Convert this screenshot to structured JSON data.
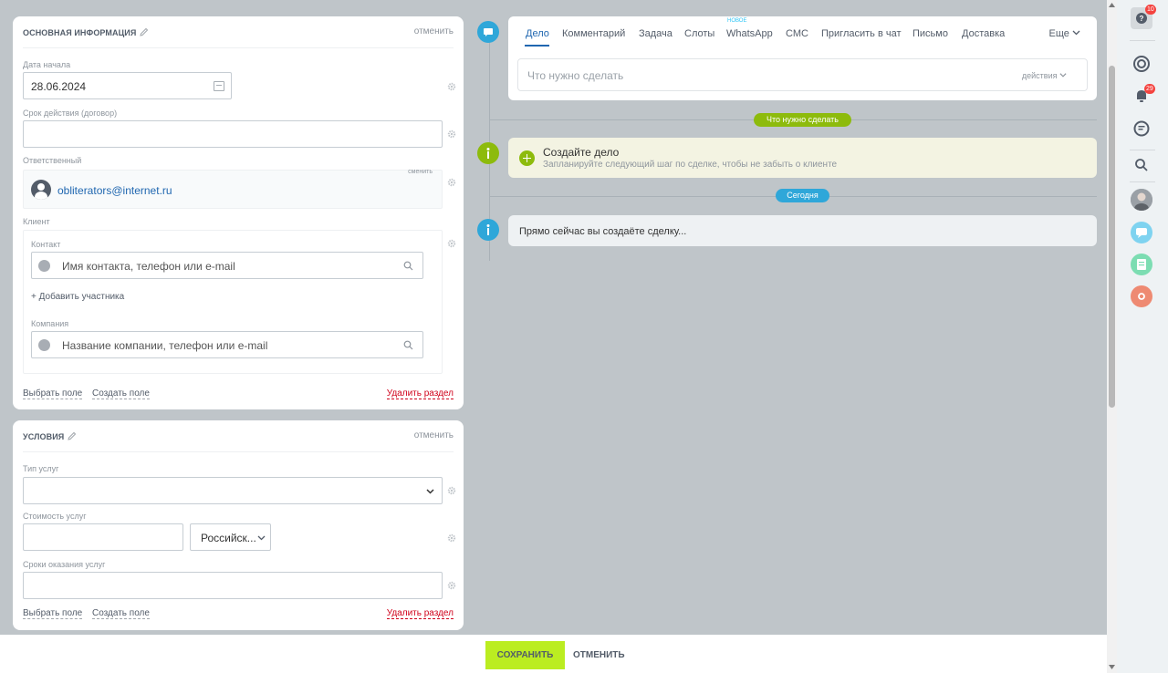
{
  "main_section": {
    "title": "ОСНОВНАЯ ИНФОРМАЦИЯ",
    "cancel": "отменить",
    "start_date_label": "Дата начала",
    "start_date_value": "28.06.2024",
    "term_label": "Срок действия (договор)",
    "term_value": "",
    "responsible_label": "Ответственный",
    "responsible_change": "сменить",
    "responsible_email": "obliterators@internet.ru",
    "client_label": "Клиент",
    "contact_label": "Контакт",
    "contact_placeholder": "Имя контакта, телефон или e-mail",
    "add_participant": "+ Добавить участника",
    "company_label": "Компания",
    "company_placeholder": "Название компании, телефон или e-mail",
    "select_field": "Выбрать поле",
    "create_field": "Создать поле",
    "delete_section": "Удалить раздел"
  },
  "conditions_section": {
    "title": "УСЛОВИЯ",
    "cancel": "отменить",
    "service_type_label": "Тип услуг",
    "service_cost_label": "Стоимость услуг",
    "currency_value": "Российск...",
    "service_terms_label": "Сроки оказания услуг",
    "select_field": "Выбрать поле",
    "create_field": "Создать поле",
    "delete_section": "Удалить раздел"
  },
  "timeline": {
    "tabs": [
      {
        "label": "Дело"
      },
      {
        "label": "Комментарий"
      },
      {
        "label": "Задача"
      },
      {
        "label": "Слоты"
      },
      {
        "label": "WhatsApp"
      },
      {
        "label": "СМС"
      },
      {
        "label": "Пригласить в чат"
      },
      {
        "label": "Письмо"
      },
      {
        "label": "Доставка"
      }
    ],
    "new_badge": "НОВОЕ",
    "more_tab": "Еще",
    "todo_placeholder": "Что нужно сделать",
    "actions": "действия",
    "todo_pill": "Что нужно сделать",
    "create_title": "Создайте дело",
    "create_subtitle": "Запланируйте следующий шаг по сделке, чтобы не забыть о клиенте",
    "today_pill": "Сегодня",
    "now_text": "Прямо сейчас вы создаёте сделку..."
  },
  "rail": {
    "help_badge": "10",
    "notifications_badge": "29"
  },
  "bottom": {
    "save": "СОХРАНИТЬ",
    "cancel": "ОТМЕНИТЬ"
  },
  "colors": {
    "accent_green": "#bbed21",
    "link_blue": "#2067b0",
    "timeline_green": "#8dbb0c",
    "timeline_blue": "#2fa7d9",
    "delete_red": "#d0021b"
  }
}
